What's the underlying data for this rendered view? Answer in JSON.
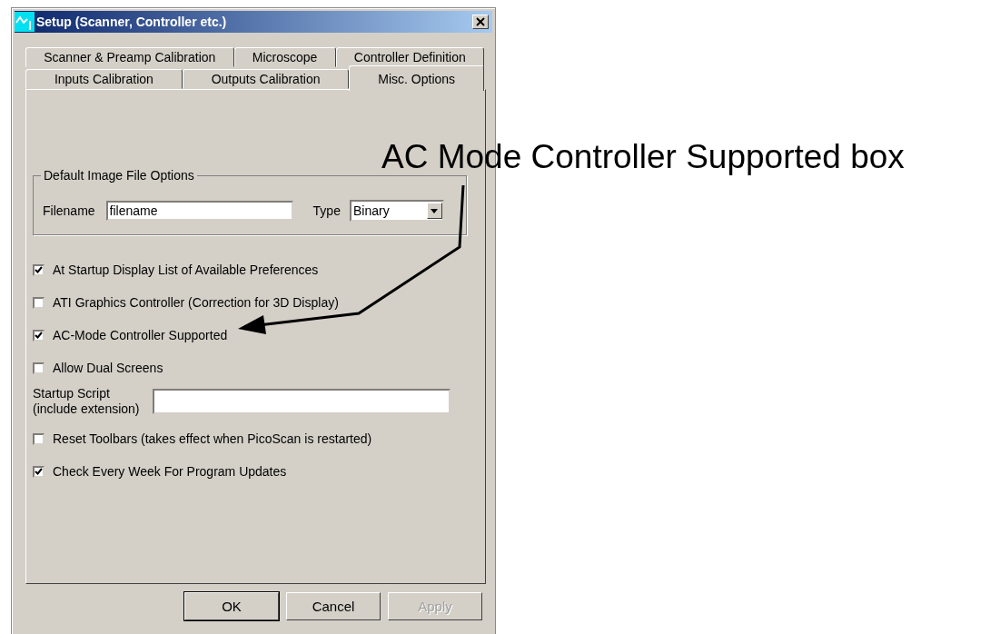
{
  "window": {
    "title": "Setup  (Scanner, Controller etc.)"
  },
  "tab_rows": [
    [
      {
        "label": "Scanner & Preamp Calibration",
        "selected": false
      },
      {
        "label": "Microscope",
        "selected": false
      },
      {
        "label": "Controller Definition",
        "selected": false
      }
    ],
    [
      {
        "label": "Inputs Calibration",
        "selected": false
      },
      {
        "label": "Outputs Calibration",
        "selected": false
      },
      {
        "label": "Misc. Options",
        "selected": true
      }
    ]
  ],
  "group": {
    "title": "Default Image File Options",
    "filename_label": "Filename",
    "filename_value": "filename",
    "type_label": "Type",
    "type_value": "Binary"
  },
  "options": [
    {
      "kind": "checkbox",
      "label": "At Startup Display List of Available Preferences",
      "checked": true
    },
    {
      "kind": "checkbox",
      "label": "ATI Graphics Controller (Correction for 3D Display)",
      "checked": false
    },
    {
      "kind": "checkbox",
      "label": "AC-Mode Controller Supported",
      "checked": true
    },
    {
      "kind": "checkbox",
      "label": "Allow Dual Screens",
      "checked": false
    },
    {
      "kind": "text_field",
      "label_lines": [
        "Startup Script",
        "(include extension)"
      ]
    },
    {
      "kind": "checkbox",
      "label": "Reset Toolbars (takes effect when PicoScan is restarted)",
      "checked": false
    },
    {
      "kind": "checkbox",
      "label": "Check Every Week For Program Updates",
      "checked": true
    }
  ],
  "buttons": [
    {
      "label": "OK",
      "disabled": false,
      "default": true
    },
    {
      "label": "Cancel",
      "disabled": false,
      "default": false
    },
    {
      "label": "Apply",
      "disabled": true,
      "default": false
    }
  ],
  "annotation": {
    "text": "AC Mode Controller Supported box"
  }
}
